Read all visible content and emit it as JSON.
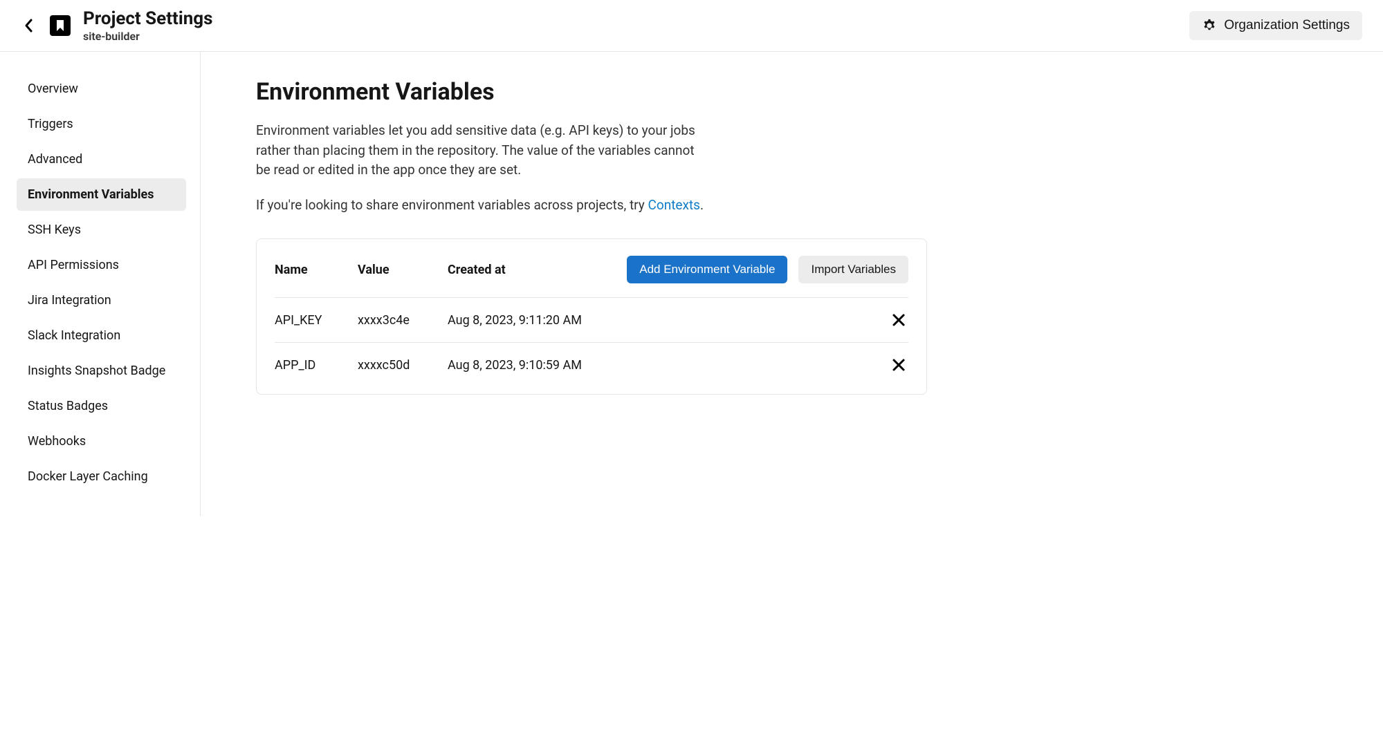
{
  "header": {
    "page_title": "Project Settings",
    "project_name": "site-builder",
    "org_settings_label": "Organization Settings"
  },
  "sidebar": {
    "items": [
      {
        "label": "Overview",
        "active": false
      },
      {
        "label": "Triggers",
        "active": false
      },
      {
        "label": "Advanced",
        "active": false
      },
      {
        "label": "Environment Variables",
        "active": true
      },
      {
        "label": "SSH Keys",
        "active": false
      },
      {
        "label": "API Permissions",
        "active": false
      },
      {
        "label": "Jira Integration",
        "active": false
      },
      {
        "label": "Slack Integration",
        "active": false
      },
      {
        "label": "Insights Snapshot Badge",
        "active": false
      },
      {
        "label": "Status Badges",
        "active": false
      },
      {
        "label": "Webhooks",
        "active": false
      },
      {
        "label": "Docker Layer Caching",
        "active": false
      }
    ]
  },
  "main": {
    "title": "Environment Variables",
    "description": "Environment variables let you add sensitive data (e.g. API keys) to your jobs rather than placing them in the repository. The value of the variables cannot be read or edited in the app once they are set.",
    "share_text_pre": "If you're looking to share environment variables across projects, try ",
    "contexts_link": "Contexts",
    "share_text_post": ".",
    "columns": {
      "name": "Name",
      "value": "Value",
      "created": "Created at"
    },
    "buttons": {
      "add": "Add Environment Variable",
      "import": "Import Variables"
    },
    "variables": [
      {
        "name": "API_KEY",
        "value": "xxxx3c4e",
        "created": "Aug 8, 2023, 9:11:20 AM"
      },
      {
        "name": "APP_ID",
        "value": "xxxxc50d",
        "created": "Aug 8, 2023, 9:10:59 AM"
      }
    ]
  }
}
